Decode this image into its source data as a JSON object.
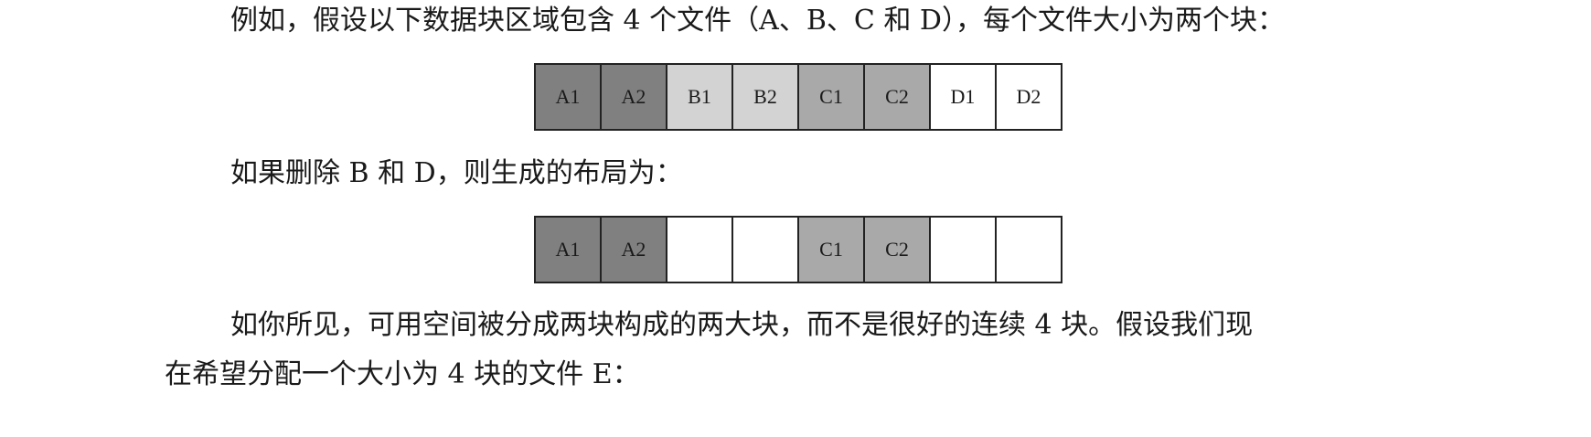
{
  "paragraphs": {
    "p1": "例如，假设以下数据块区域包含 4 个文件（A、B、C 和 D），每个文件大小为两个块：",
    "p2": "如果删除 B 和 D，则生成的布局为：",
    "p3_line1": "如你所见，可用空间被分成两块构成的两大块，而不是很好的连续  4  块。假设我们现",
    "p3_line2": "在希望分配一个大小为 4 块的文件 E："
  },
  "layout_before": [
    {
      "label": "A1",
      "color": "#808080"
    },
    {
      "label": "A2",
      "color": "#808080"
    },
    {
      "label": "B1",
      "color": "#d3d3d3"
    },
    {
      "label": "B2",
      "color": "#d3d3d3"
    },
    {
      "label": "C1",
      "color": "#a9a9a9"
    },
    {
      "label": "C2",
      "color": "#a9a9a9"
    },
    {
      "label": "D1",
      "color": "#ffffff"
    },
    {
      "label": "D2",
      "color": "#ffffff"
    }
  ],
  "layout_after": [
    {
      "label": "A1",
      "color": "#808080"
    },
    {
      "label": "A2",
      "color": "#808080"
    },
    {
      "label": "",
      "color": "#ffffff"
    },
    {
      "label": "",
      "color": "#ffffff"
    },
    {
      "label": "C1",
      "color": "#a9a9a9"
    },
    {
      "label": "C2",
      "color": "#a9a9a9"
    },
    {
      "label": "",
      "color": "#ffffff"
    },
    {
      "label": "",
      "color": "#ffffff"
    }
  ]
}
